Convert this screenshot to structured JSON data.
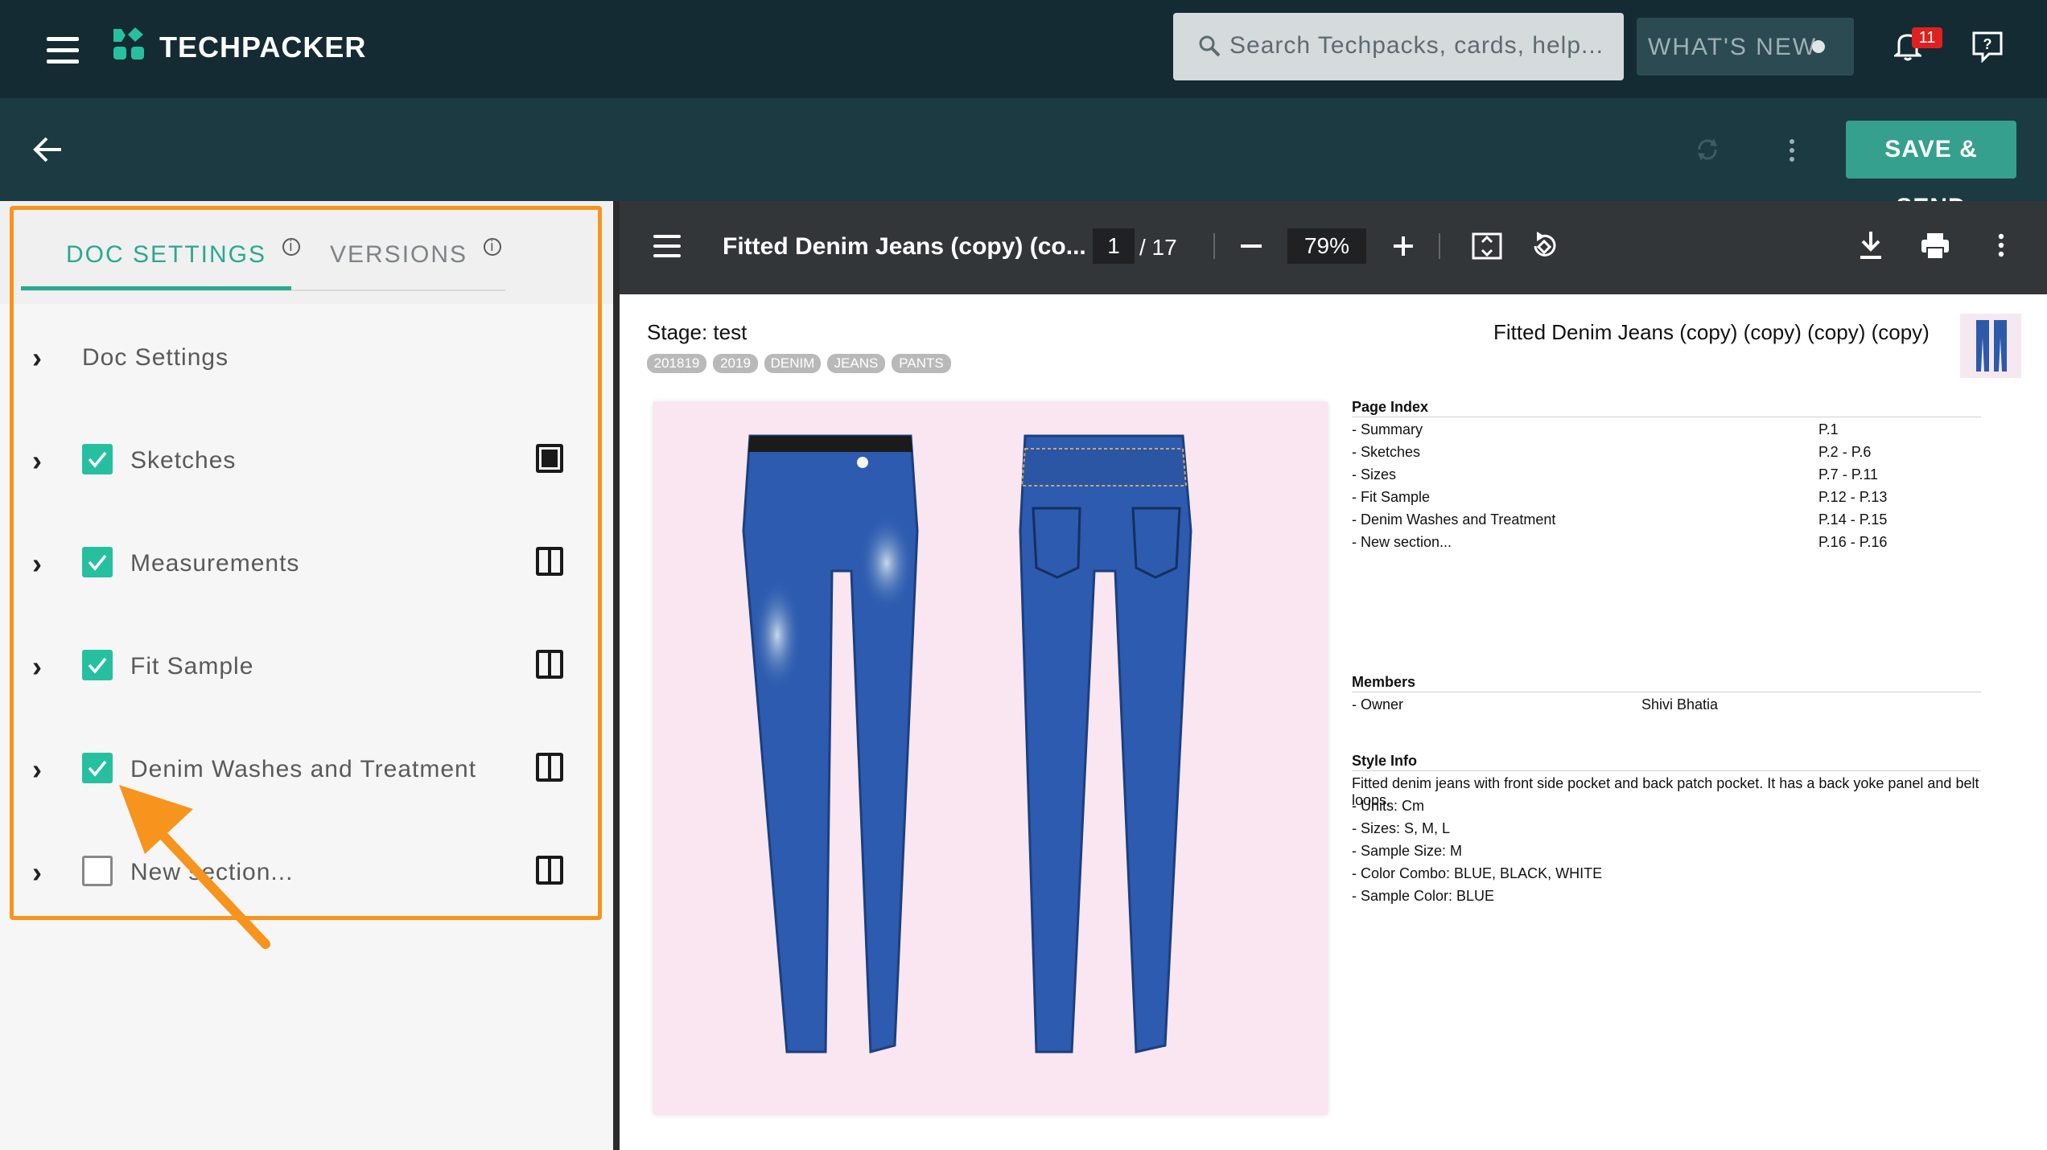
{
  "app": {
    "name": "TECHPACKER"
  },
  "topbar": {
    "search_placeholder": "Search Techpacks, cards, help...",
    "whats_new": "WHAT'S NEW",
    "notification_count": "11",
    "icons": [
      "menu-icon",
      "logo-icon",
      "search-icon",
      "notification-bell-icon",
      "help-icon"
    ]
  },
  "subbar": {
    "save_send": "SAVE & SEND",
    "icons": [
      "back-arrow-icon",
      "sync-icon",
      "more-vertical-icon"
    ]
  },
  "left_panel": {
    "tabs": [
      {
        "label": "DOC SETTINGS",
        "active": true
      },
      {
        "label": "VERSIONS",
        "active": false
      }
    ],
    "sections": [
      {
        "label": "Doc Settings",
        "has_checkbox": false
      },
      {
        "label": "Sketches",
        "checked": true
      },
      {
        "label": "Measurements",
        "checked": true
      },
      {
        "label": "Fit Sample",
        "checked": true
      },
      {
        "label": "Denim Washes and Treatment",
        "checked": true
      },
      {
        "label": "New section...",
        "checked": false
      }
    ]
  },
  "viewer": {
    "title": "Fitted Denim Jeans (copy) (co...",
    "page_current": "1",
    "page_total": "/ 17",
    "zoom": "79%",
    "icons": [
      "menu-icon",
      "zoom-out-icon",
      "zoom-in-icon",
      "fit-page-icon",
      "rotate-icon",
      "download-icon",
      "print-icon",
      "more-vertical-icon"
    ]
  },
  "document": {
    "stage": "Stage: test",
    "tags": [
      "201819",
      "2019",
      "DENIM",
      "JEANS",
      "PANTS"
    ],
    "product_title": "Fitted Denim Jeans (copy) (copy) (copy) (copy)",
    "page_index": {
      "heading": "Page Index",
      "rows": [
        {
          "name": "- Summary",
          "pages": "P.1"
        },
        {
          "name": "- Sketches",
          "pages": "P.2 - P.6"
        },
        {
          "name": "- Sizes",
          "pages": "P.7 - P.11"
        },
        {
          "name": "- Fit Sample",
          "pages": "P.12 - P.13"
        },
        {
          "name": "- Denim Washes and Treatment",
          "pages": "P.14 - P.15"
        },
        {
          "name": "- New section...",
          "pages": "P.16 - P.16"
        }
      ]
    },
    "members": {
      "heading": "Members",
      "role": "- Owner",
      "name": "Shivi Bhatia"
    },
    "style_info": {
      "heading": "Style Info",
      "description": "Fitted denim jeans with front side pocket and back patch pocket. It has a back yoke panel and belt loops.",
      "lines": [
        "- Units: Cm",
        "- Sizes: S, M, L",
        "- Sample Size: M",
        "- Color Combo: BLUE, BLACK, WHITE",
        "- Sample Color: BLUE"
      ]
    }
  }
}
